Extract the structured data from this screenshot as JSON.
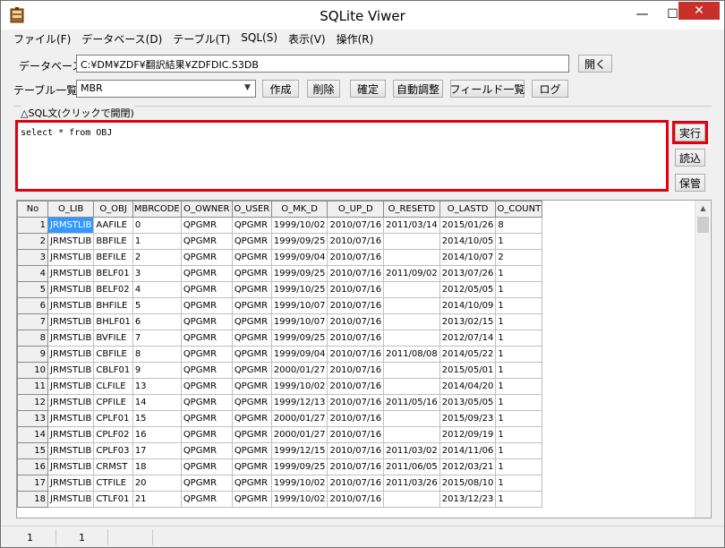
{
  "window": {
    "title": "SQLite Viwer",
    "controls": {
      "minimize": "—",
      "maximize": "☐",
      "close": "✕"
    }
  },
  "menu": [
    "ファイル(F)",
    "データベース(D)",
    "テーブル(T)",
    "SQL(S)",
    "表示(V)",
    "操作(R)"
  ],
  "database": {
    "label": "データベース",
    "path": "C:¥DM¥ZDF¥翻訳結果¥ZDFDIC.S3DB",
    "open_button": "開く"
  },
  "table_list": {
    "label": "テーブル一覧",
    "selected": "MBR",
    "buttons": [
      "作成",
      "削除",
      "確定",
      "自動調整",
      "フィールド一覧",
      "ログ"
    ]
  },
  "sql": {
    "group_title": "△SQL文(クリックで開閉)",
    "text": "select * from OBJ",
    "execute_button": "実行",
    "load_button": "読込",
    "save_button": "保管"
  },
  "grid": {
    "columns": [
      "No",
      "O_LIB",
      "O_OBJ",
      "MBRCODE",
      "O_OWNER",
      "O_USER",
      "O_MK_D",
      "O_UP_D",
      "O_RESETD",
      "O_LASTD",
      "O_COUNT"
    ],
    "rows": [
      [
        "1",
        "JRMSTLIB",
        "AAFILE",
        "0",
        "QPGMR",
        "QPGMR",
        "1999/10/02",
        "2010/07/16",
        "2011/03/14",
        "2015/01/26",
        "8"
      ],
      [
        "2",
        "JRMSTLIB",
        "BBFILE",
        "1",
        "QPGMR",
        "QPGMR",
        "1999/09/25",
        "2010/07/16",
        "",
        "2014/10/05",
        "1"
      ],
      [
        "3",
        "JRMSTLIB",
        "BEFILE",
        "2",
        "QPGMR",
        "QPGMR",
        "1999/09/04",
        "2010/07/16",
        "",
        "2014/10/07",
        "2"
      ],
      [
        "4",
        "JRMSTLIB",
        "BELF01",
        "3",
        "QPGMR",
        "QPGMR",
        "1999/09/25",
        "2010/07/16",
        "2011/09/02",
        "2013/07/26",
        "1"
      ],
      [
        "5",
        "JRMSTLIB",
        "BELF02",
        "4",
        "QPGMR",
        "QPGMR",
        "1999/10/25",
        "2010/07/16",
        "",
        "2012/05/05",
        "1"
      ],
      [
        "6",
        "JRMSTLIB",
        "BHFILE",
        "5",
        "QPGMR",
        "QPGMR",
        "1999/10/07",
        "2010/07/16",
        "",
        "2014/10/09",
        "1"
      ],
      [
        "7",
        "JRMSTLIB",
        "BHLF01",
        "6",
        "QPGMR",
        "QPGMR",
        "1999/10/07",
        "2010/07/16",
        "",
        "2013/02/15",
        "1"
      ],
      [
        "8",
        "JRMSTLIB",
        "BVFILE",
        "7",
        "QPGMR",
        "QPGMR",
        "1999/09/25",
        "2010/07/16",
        "",
        "2012/07/14",
        "1"
      ],
      [
        "9",
        "JRMSTLIB",
        "CBFILE",
        "8",
        "QPGMR",
        "QPGMR",
        "1999/09/04",
        "2010/07/16",
        "2011/08/08",
        "2014/05/22",
        "1"
      ],
      [
        "10",
        "JRMSTLIB",
        "CBLF01",
        "9",
        "QPGMR",
        "QPGMR",
        "2000/01/27",
        "2010/07/16",
        "",
        "2015/05/01",
        "1"
      ],
      [
        "11",
        "JRMSTLIB",
        "CLFILE",
        "13",
        "QPGMR",
        "QPGMR",
        "1999/10/02",
        "2010/07/16",
        "",
        "2014/04/20",
        "1"
      ],
      [
        "12",
        "JRMSTLIB",
        "CPFILE",
        "14",
        "QPGMR",
        "QPGMR",
        "1999/12/13",
        "2010/07/16",
        "2011/05/16",
        "2013/05/05",
        "1"
      ],
      [
        "13",
        "JRMSTLIB",
        "CPLF01",
        "15",
        "QPGMR",
        "QPGMR",
        "2000/01/27",
        "2010/07/16",
        "",
        "2015/09/23",
        "1"
      ],
      [
        "14",
        "JRMSTLIB",
        "CPLF02",
        "16",
        "QPGMR",
        "QPGMR",
        "2000/01/27",
        "2010/07/16",
        "",
        "2012/09/19",
        "1"
      ],
      [
        "15",
        "JRMSTLIB",
        "CPLF03",
        "17",
        "QPGMR",
        "QPGMR",
        "1999/12/15",
        "2010/07/16",
        "2011/03/02",
        "2014/11/06",
        "1"
      ],
      [
        "16",
        "JRMSTLIB",
        "CRMST",
        "18",
        "QPGMR",
        "QPGMR",
        "1999/09/25",
        "2010/07/16",
        "2011/06/05",
        "2012/03/21",
        "1"
      ],
      [
        "17",
        "JRMSTLIB",
        "CTFILE",
        "20",
        "QPGMR",
        "QPGMR",
        "1999/10/02",
        "2010/07/16",
        "2011/03/26",
        "2015/08/10",
        "1"
      ],
      [
        "18",
        "JRMSTLIB",
        "CTLF01",
        "21",
        "QPGMR",
        "QPGMR",
        "1999/10/02",
        "2010/07/16",
        "",
        "2013/12/23",
        "1"
      ]
    ]
  },
  "status": [
    "1",
    "1"
  ]
}
